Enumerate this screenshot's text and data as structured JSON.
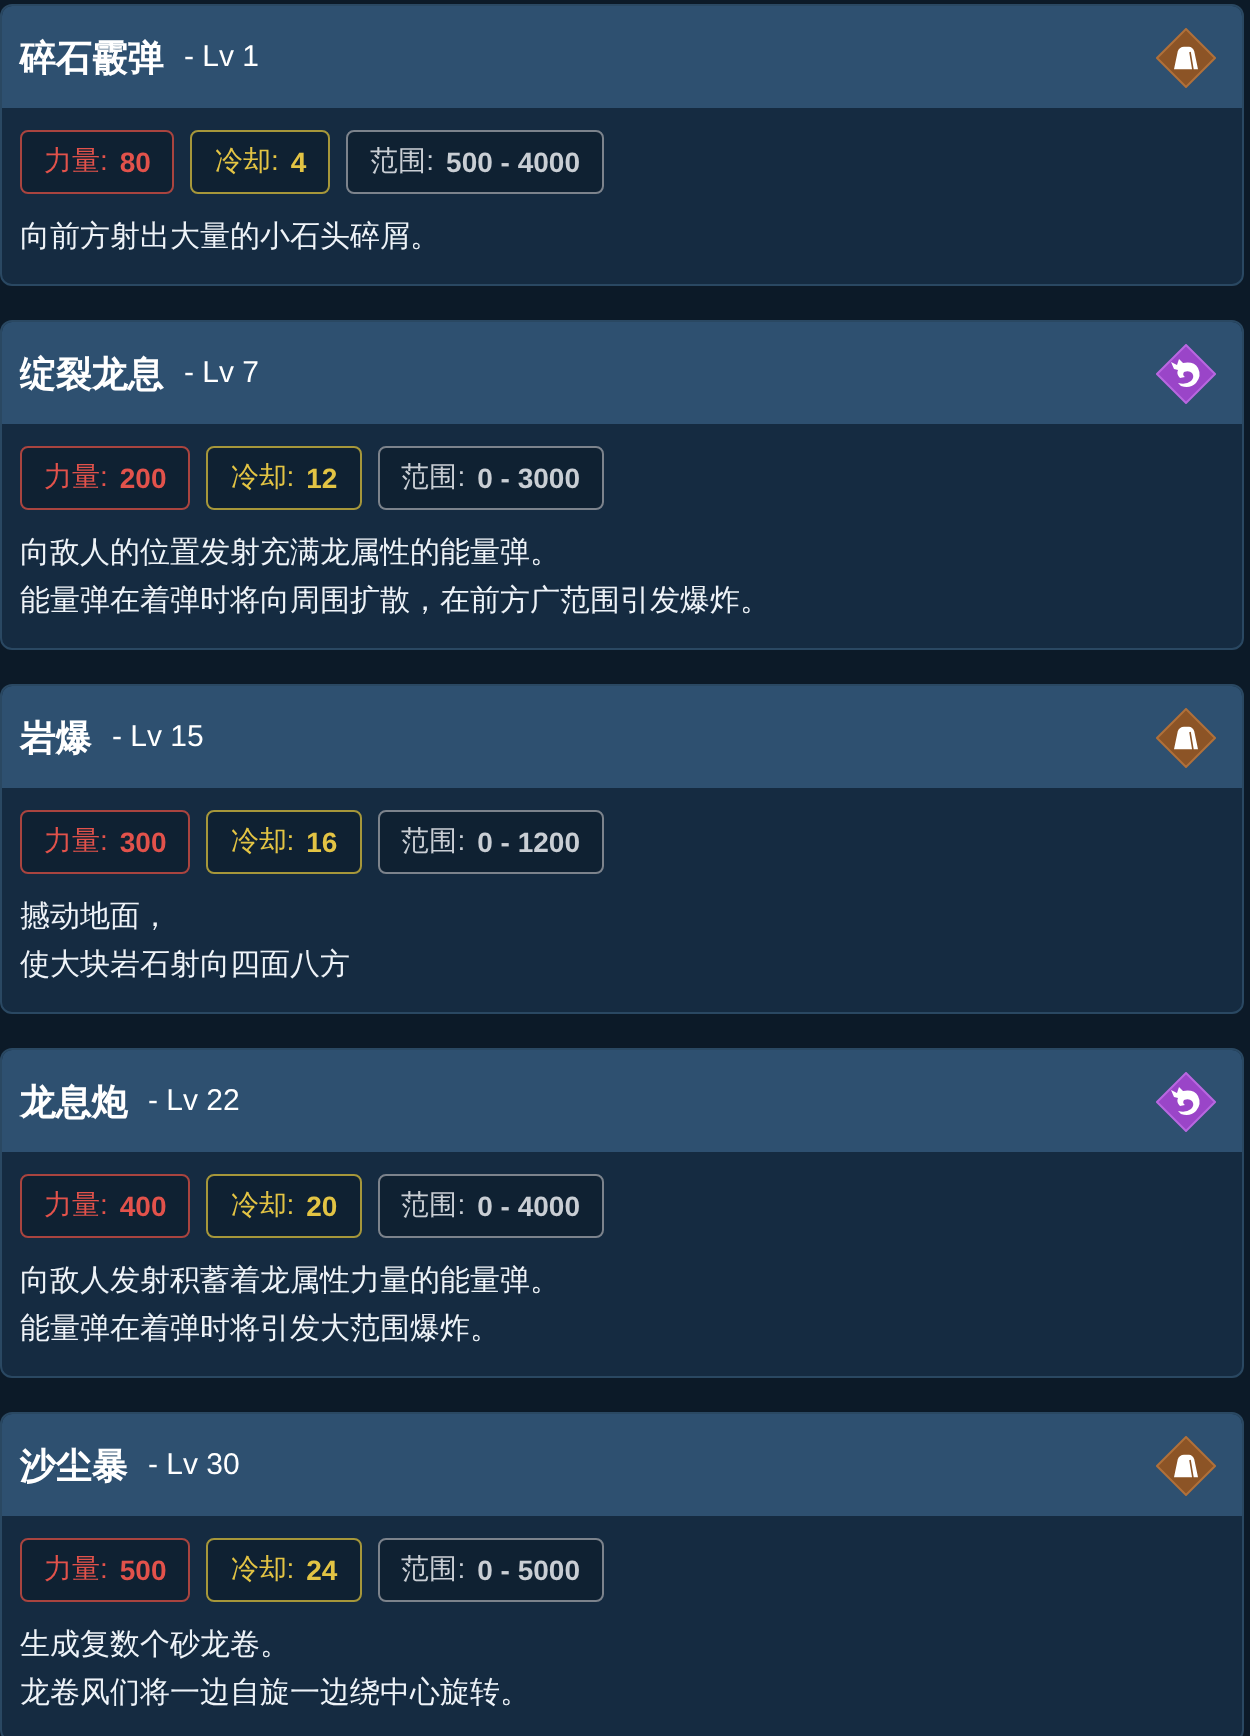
{
  "skills": [
    {
      "name": "碎石霰弹",
      "level": "- Lv 1",
      "kind": "earth",
      "stats": [
        {
          "kind": "power",
          "label": "力量:",
          "value": "80"
        },
        {
          "kind": "cooldown",
          "label": "冷却:",
          "value": "4"
        },
        {
          "kind": "range",
          "label": "范围:",
          "value": "500 - 4000"
        }
      ],
      "description": [
        "向前方射出大量的小石头碎屑。"
      ]
    },
    {
      "name": "绽裂龙息",
      "level": "- Lv 7",
      "kind": "dragon",
      "stats": [
        {
          "kind": "power",
          "label": "力量:",
          "value": "200"
        },
        {
          "kind": "cooldown",
          "label": "冷却:",
          "value": "12"
        },
        {
          "kind": "range",
          "label": "范围:",
          "value": "0 - 3000"
        }
      ],
      "description": [
        "向敌人的位置发射充满龙属性的能量弹。",
        "能量弹在着弹时将向周围扩散，在前方广范围引发爆炸。"
      ]
    },
    {
      "name": "岩爆",
      "level": "- Lv 15",
      "kind": "earth",
      "stats": [
        {
          "kind": "power",
          "label": "力量:",
          "value": "300"
        },
        {
          "kind": "cooldown",
          "label": "冷却:",
          "value": "16"
        },
        {
          "kind": "range",
          "label": "范围:",
          "value": "0 - 1200"
        }
      ],
      "description": [
        "撼动地面，",
        "使大块岩石射向四面八方"
      ]
    },
    {
      "name": "龙息炮",
      "level": "- Lv 22",
      "kind": "dragon",
      "stats": [
        {
          "kind": "power",
          "label": "力量:",
          "value": "400"
        },
        {
          "kind": "cooldown",
          "label": "冷却:",
          "value": "20"
        },
        {
          "kind": "range",
          "label": "范围:",
          "value": "0 - 4000"
        }
      ],
      "description": [
        "向敌人发射积蓄着龙属性力量的能量弹。",
        "能量弹在着弹时将引发大范围爆炸。"
      ]
    },
    {
      "name": "沙尘暴",
      "level": "- Lv 30",
      "kind": "earth",
      "stats": [
        {
          "kind": "power",
          "label": "力量:",
          "value": "500"
        },
        {
          "kind": "cooldown",
          "label": "冷却:",
          "value": "24"
        },
        {
          "kind": "range",
          "label": "范围:",
          "value": "0 - 5000"
        }
      ],
      "description": [
        "生成复数个砂龙卷。",
        "龙卷风们将一边自旋一边绕中心旋转。"
      ]
    }
  ]
}
